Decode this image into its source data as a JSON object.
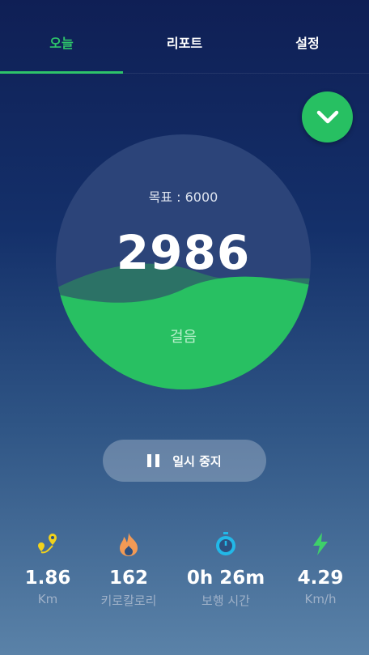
{
  "tabs": [
    {
      "label": "오늘",
      "active": true
    },
    {
      "label": "리포트",
      "active": false
    },
    {
      "label": "설정",
      "active": false
    }
  ],
  "collapse_button": {
    "icon": "chevron-down-icon"
  },
  "progress": {
    "goal_text": "목표 : 6000",
    "steps": "2986",
    "steps_label": "걸음",
    "goal": 6000,
    "current": 2986
  },
  "pause_button": {
    "label": "일시 중지",
    "icon": "pause-icon"
  },
  "stats": [
    {
      "icon": "route-icon",
      "value": "1.86",
      "unit": "Km",
      "color": "#f2d21b"
    },
    {
      "icon": "flame-icon",
      "value": "162",
      "unit": "키로칼로리",
      "color": "#f29a55"
    },
    {
      "icon": "stopwatch-icon",
      "value": "0h 26m",
      "unit": "보행 시간",
      "color": "#22b8e8"
    },
    {
      "icon": "lightning-icon",
      "value": "4.29",
      "unit": "Km/h",
      "color": "#3ed06a"
    }
  ],
  "colors": {
    "accent": "#27c062",
    "background_top": "#0f1f55",
    "background_bottom": "#5a82a8"
  }
}
